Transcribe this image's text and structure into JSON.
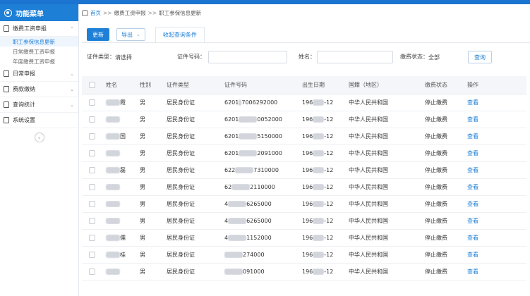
{
  "sidebar": {
    "title": "功能菜单",
    "groups": [
      {
        "label": "缴费工资申报",
        "expanded": true,
        "items": [
          {
            "label": "职工参保信息更新",
            "active": true
          },
          {
            "label": "日常缴费工资申报",
            "active": false
          },
          {
            "label": "年度缴费工资申报",
            "active": false
          }
        ]
      },
      {
        "label": "日常申报",
        "expanded": false
      },
      {
        "label": "费款缴纳",
        "expanded": false
      },
      {
        "label": "查询统计",
        "expanded": false
      },
      {
        "label": "系统设置",
        "expanded": false
      }
    ]
  },
  "breadcrumb": {
    "home": "首页",
    "sep": ">>",
    "level1": "缴费工资申报",
    "level2": "职工参保信息更新"
  },
  "toolbar": {
    "update": "更新",
    "export": "导出",
    "tab": "收起查询条件"
  },
  "filters": {
    "id_type_label": "证件类型：",
    "id_type_value": "请选择",
    "id_number_label": "证件号码：",
    "name_label": "姓名：",
    "status_label": "缴费状态：",
    "status_value": "全部",
    "search": "查询"
  },
  "table": {
    "headers": [
      "姓名",
      "性别",
      "证件类型",
      "证件号码",
      "出生日期",
      "国籍（地区）",
      "缴费状态",
      "操作"
    ],
    "rows": [
      {
        "name": "霞",
        "sex": "男",
        "type": "居民身份证",
        "id_a": "6201",
        "id_b": "7006292000",
        "dob_a": "196",
        "dob_b": "-12",
        "nation": "中华人民共和国",
        "status": "停止缴费",
        "op": "查看"
      },
      {
        "name": "",
        "sex": "男",
        "type": "居民身份证",
        "id_a": "6201",
        "id_b": "0052000",
        "dob_a": "196",
        "dob_b": "-12",
        "nation": "中华人民共和国",
        "status": "停止缴费",
        "op": "查看"
      },
      {
        "name": "国",
        "sex": "男",
        "type": "居民身份证",
        "id_a": "6201",
        "id_b": "5150000",
        "dob_a": "196",
        "dob_b": "-12",
        "nation": "中华人民共和国",
        "status": "停止缴费",
        "op": "查看"
      },
      {
        "name": "",
        "sex": "男",
        "type": "居民身份证",
        "id_a": "6201",
        "id_b": "2091000",
        "dob_a": "196",
        "dob_b": "-12",
        "nation": "中华人民共和国",
        "status": "停止缴费",
        "op": "查看"
      },
      {
        "name": "磊",
        "sex": "男",
        "type": "居民身份证",
        "id_a": "622",
        "id_b": "7310000",
        "dob_a": "196",
        "dob_b": "-12",
        "nation": "中华人民共和国",
        "status": "停止缴费",
        "op": "查看"
      },
      {
        "name": "",
        "sex": "男",
        "type": "居民身份证",
        "id_a": "62",
        "id_b": "2110000",
        "dob_a": "196",
        "dob_b": "-12",
        "nation": "中华人民共和国",
        "status": "停止缴费",
        "op": "查看"
      },
      {
        "name": "",
        "sex": "男",
        "type": "居民身份证",
        "id_a": "4",
        "id_b": "6265000",
        "dob_a": "196",
        "dob_b": "-12",
        "nation": "中华人民共和国",
        "status": "停止缴费",
        "op": "查看"
      },
      {
        "name": "",
        "sex": "男",
        "type": "居民身份证",
        "id_a": "4",
        "id_b": "6265000",
        "dob_a": "196",
        "dob_b": "-12",
        "nation": "中华人民共和国",
        "status": "停止缴费",
        "op": "查看"
      },
      {
        "name": "儒",
        "sex": "男",
        "type": "居民身份证",
        "id_a": "4",
        "id_b": "1152000",
        "dob_a": "196",
        "dob_b": "-12",
        "nation": "中华人民共和国",
        "status": "停止缴费",
        "op": "查看"
      },
      {
        "name": "桂",
        "sex": "男",
        "type": "居民身份证",
        "id_a": "",
        "id_b": "274000",
        "dob_a": "196",
        "dob_b": "-12",
        "nation": "中华人民共和国",
        "status": "停止缴费",
        "op": "查看"
      },
      {
        "name": "",
        "sex": "男",
        "type": "居民身份证",
        "id_a": "",
        "id_b": "091000",
        "dob_a": "196",
        "dob_b": "-12",
        "nation": "中华人民共和国",
        "status": "停止缴费",
        "op": "查看"
      }
    ]
  }
}
